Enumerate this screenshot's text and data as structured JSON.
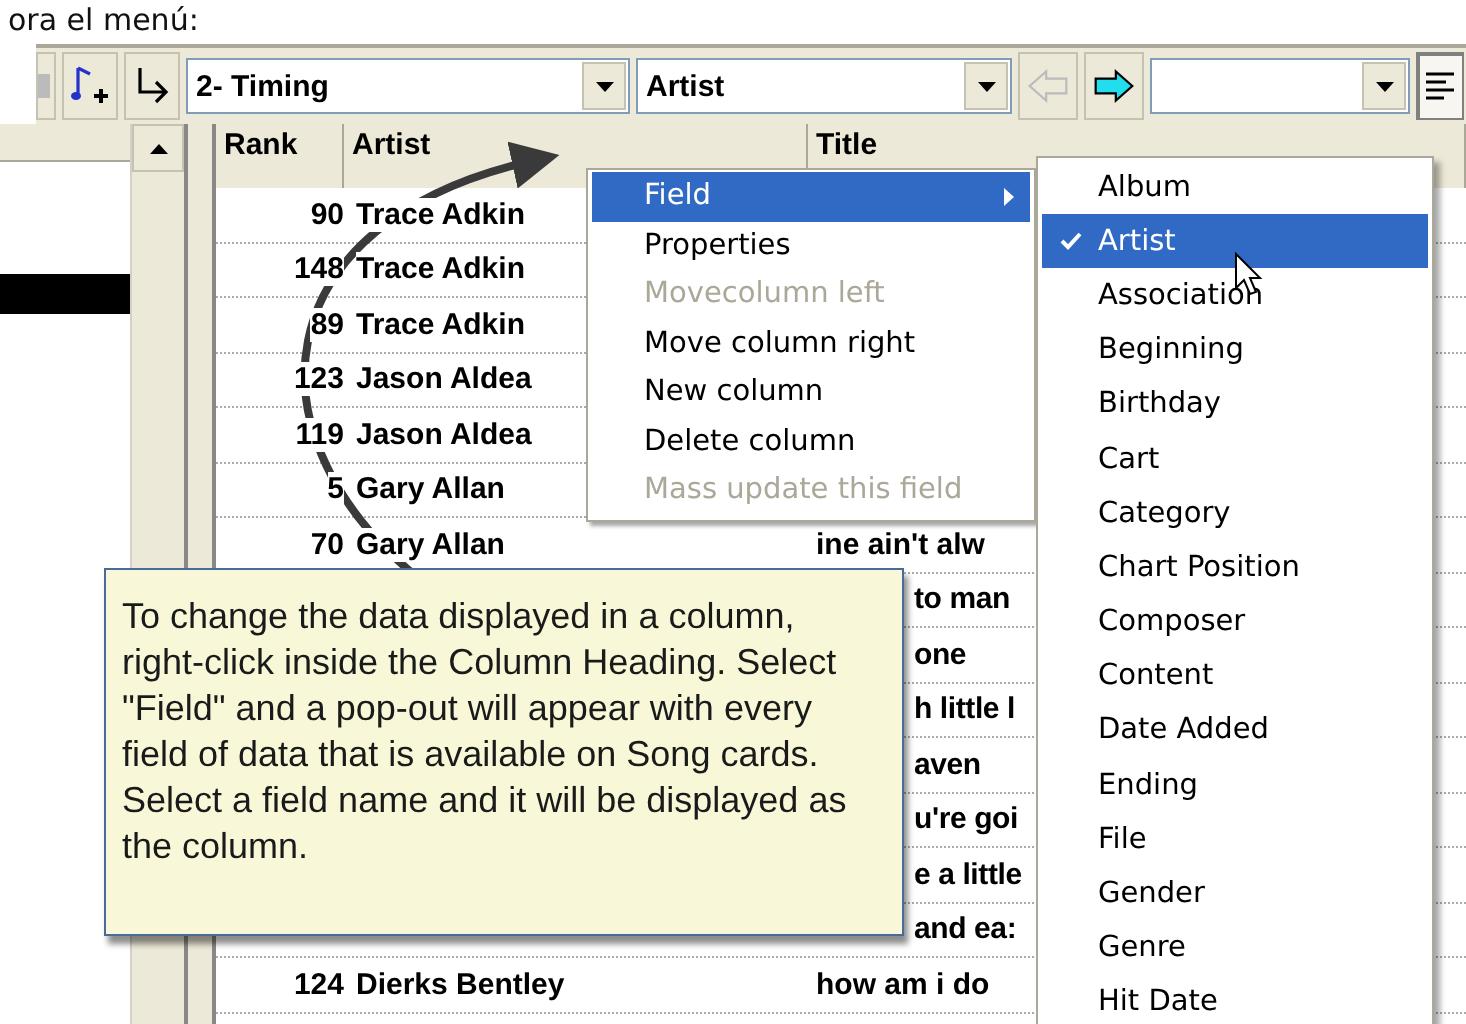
{
  "caption": "ora el menú:",
  "toolbar": {
    "layout_combo": {
      "value": "2- Timing"
    },
    "field_combo": {
      "value": "Artist"
    },
    "back_button": {
      "disabled": true
    },
    "forward_button": {
      "disabled": false
    },
    "align_button": {
      "pressed": true
    }
  },
  "grid": {
    "columns": [
      "Rank",
      "Artist",
      "Title"
    ],
    "rows": [
      {
        "kind": "full",
        "rank": "90",
        "artist": "Trace Adkin"
      },
      {
        "kind": "full",
        "rank": "148",
        "artist": "Trace Adkin"
      },
      {
        "kind": "full",
        "rank": "89",
        "artist": "Trace Adkin"
      },
      {
        "kind": "full",
        "rank": "123",
        "artist": "Jason Aldea"
      },
      {
        "kind": "full",
        "rank": "119",
        "artist": "Jason Aldea"
      },
      {
        "kind": "full",
        "rank": "5",
        "artist": "Gary Allan"
      },
      {
        "kind": "full",
        "rank": "70",
        "artist": "Gary Allan",
        "title": "ine ain't alw"
      },
      {
        "kind": "covered",
        "title": "to man"
      },
      {
        "kind": "covered",
        "title": "one"
      },
      {
        "kind": "covered",
        "title": "h little l"
      },
      {
        "kind": "covered",
        "title": "aven"
      },
      {
        "kind": "covered",
        "title": "u're goi"
      },
      {
        "kind": "covered",
        "title": "e a little"
      },
      {
        "kind": "covered",
        "title": "and ea:"
      },
      {
        "kind": "full",
        "rank": "124",
        "artist": "Dierks Bentley",
        "title": "how am i do"
      }
    ]
  },
  "context_menu": {
    "items": [
      {
        "label": "Field",
        "selected": true,
        "disabled": false,
        "submenu": true
      },
      {
        "label": "Properties",
        "selected": false,
        "disabled": false,
        "submenu": false
      },
      {
        "label": "Movecolumn left",
        "selected": false,
        "disabled": true,
        "submenu": false
      },
      {
        "label": "Move column right",
        "selected": false,
        "disabled": false,
        "submenu": false
      },
      {
        "label": "New column",
        "selected": false,
        "disabled": false,
        "submenu": false
      },
      {
        "label": "Delete column",
        "selected": false,
        "disabled": false,
        "submenu": false
      },
      {
        "label": "Mass update this field",
        "selected": false,
        "disabled": true,
        "submenu": false
      }
    ]
  },
  "field_submenu": {
    "items": [
      {
        "label": "Album",
        "selected": false,
        "checked": false
      },
      {
        "label": "Artist",
        "selected": true,
        "checked": true
      },
      {
        "label": "Association",
        "selected": false,
        "checked": false
      },
      {
        "label": "Beginning",
        "selected": false,
        "checked": false
      },
      {
        "label": "Birthday",
        "selected": false,
        "checked": false
      },
      {
        "label": "Cart",
        "selected": false,
        "checked": false
      },
      {
        "label": "Category",
        "selected": false,
        "checked": false
      },
      {
        "label": "Chart Position",
        "selected": false,
        "checked": false
      },
      {
        "label": "Composer",
        "selected": false,
        "checked": false
      },
      {
        "label": "Content",
        "selected": false,
        "checked": false
      },
      {
        "label": "Date Added",
        "selected": false,
        "checked": false
      },
      {
        "label": "Ending",
        "selected": false,
        "checked": false
      },
      {
        "label": "File",
        "selected": false,
        "checked": false
      },
      {
        "label": "Gender",
        "selected": false,
        "checked": false
      },
      {
        "label": "Genre",
        "selected": false,
        "checked": false
      },
      {
        "label": "Hit Date",
        "selected": false,
        "checked": false
      }
    ]
  },
  "callout": {
    "text": "To change the data displayed in a column, right-click inside the Column Heading.  Select \"Field\" and a pop-out will appear with every field of data that is available on Song cards. Select a field name and it will be displayed as the column."
  }
}
